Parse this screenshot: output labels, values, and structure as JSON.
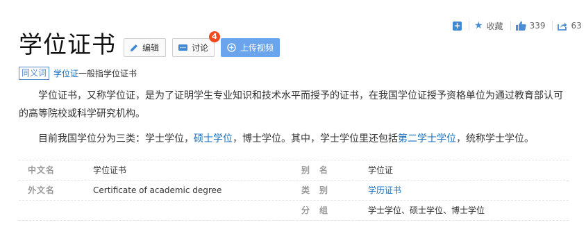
{
  "toolbar": {
    "add_symbol": "+",
    "favorite_label": "收藏",
    "like_count": "339",
    "share_count": "63"
  },
  "header": {
    "title": "学位证书",
    "edit_label": "编辑",
    "discuss_label": "讨论",
    "discuss_badge": "4",
    "upload_label": "上传视频"
  },
  "synonym": {
    "tag": "同义词",
    "term": "学位证",
    "text": "一般指学位证书"
  },
  "intro": {
    "p1": "学位证书，又称学位证，是为了证明学生专业知识和技术水平而授予的证书，在我国学位证授予资格单位为通过教育部认可的高等院校或科学研究机构。",
    "p2_a": "目前我国学位分为三类：学士学位，",
    "p2_link1": "硕士学位",
    "p2_b": "，博士学位。其中，学士学位里还包括",
    "p2_link2": "第二学士学位",
    "p2_c": "，统称学士学位。"
  },
  "infobox": {
    "rows": [
      {
        "left_label": "中文名",
        "left_value": "学位证书",
        "right_label": "别　名",
        "right_value": "学位证"
      },
      {
        "left_label": "外文名",
        "left_value": "Certificate of academic degree",
        "right_label": "类　别",
        "right_value": "学历证书"
      },
      {
        "left_label": "",
        "left_value": "",
        "right_label": "分　组",
        "right_value": "学士学位、硕士学位、博士学位"
      }
    ]
  },
  "colors": {
    "accent_link": "#136ec2",
    "upload_button": "#6aa4ec",
    "badge": "#f0491b",
    "icon_blue": "#4b8ed6"
  }
}
